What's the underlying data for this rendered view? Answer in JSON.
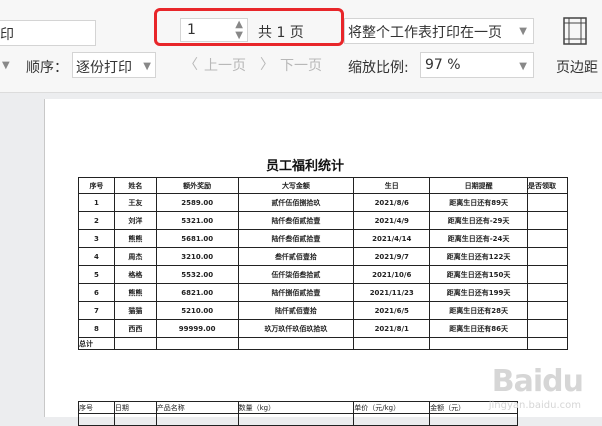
{
  "toolbar": {
    "mode_fragment": "印",
    "order_label": "顺序：",
    "order_value": "逐份打印",
    "page_current": "1",
    "page_total": "共 1 页",
    "prev_page": "上一页",
    "next_page": "下一页",
    "fit_value": "将整个工作表打印在一页",
    "zoom_label": "缩放比例:",
    "zoom_value": "97 %",
    "margin_button": "页边距"
  },
  "sheet": {
    "title": "员工福利统计",
    "headers": [
      "序号",
      "姓名",
      "额外奖励",
      "大写金额",
      "生日",
      "日期提醒",
      "是否领取"
    ],
    "rows": [
      [
        "1",
        "王友",
        "2589.00",
        "贰仟伍佰捌拾玖",
        "2021/8/6",
        "距离生日还有89天",
        ""
      ],
      [
        "2",
        "刘洋",
        "5321.00",
        "陆仟叁佰贰拾壹",
        "2021/4/9",
        "距离生日还有-29天",
        ""
      ],
      [
        "3",
        "熊熊",
        "5681.00",
        "陆仟叁佰贰拾壹",
        "2021/4/14",
        "距离生日还有-24天",
        ""
      ],
      [
        "4",
        "周杰",
        "3210.00",
        "叁仟贰佰壹拾",
        "2021/9/7",
        "距离生日还有122天",
        ""
      ],
      [
        "5",
        "格格",
        "5532.00",
        "伍仟柒佰叁拾贰",
        "2021/10/6",
        "距离生日还有150天",
        ""
      ],
      [
        "6",
        "熊熊",
        "6821.00",
        "陆仟捌佰贰拾壹",
        "2021/11/23",
        "距离生日还有199天",
        ""
      ],
      [
        "7",
        "猫猫",
        "5210.00",
        "陆仟贰佰壹拾",
        "2021/6/5",
        "距离生日还有28天",
        ""
      ],
      [
        "8",
        "西西",
        "99999.00",
        "玖万玖仟玖佰玖拾玖",
        "2021/8/1",
        "距离生日还有86天",
        ""
      ]
    ],
    "total_label": "总计",
    "second_headers": [
      "序号",
      "日期",
      "产品名称",
      "数量（kg）",
      "单价（元/kg）",
      "金额（元）"
    ]
  },
  "watermark": {
    "brand": "Baidu",
    "sub": "jingyan.baidu.com"
  }
}
